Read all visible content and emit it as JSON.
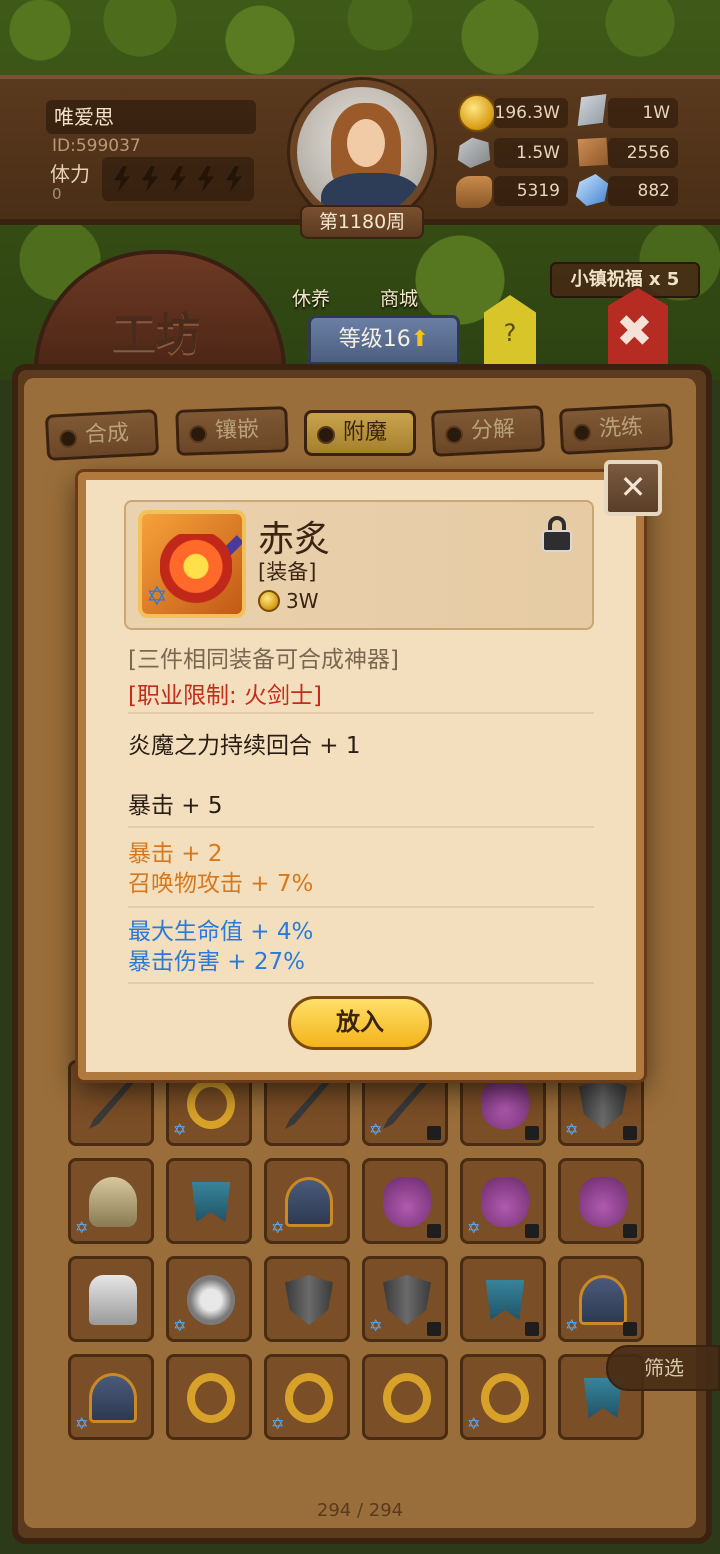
{
  "player": {
    "name": "唯爱思",
    "id": "ID:599037",
    "stamina_label": "体力",
    "stamina_value": "0",
    "week": "第1180周"
  },
  "resources": {
    "gold": "196.3W",
    "iron": "1W",
    "stone": "1.5W",
    "leather": "2556",
    "wood": "5319",
    "crystal": "882"
  },
  "nav": {
    "workshop_title": "工坊",
    "rest_label": "休养",
    "shop_label": "商城",
    "level_label": "等级16",
    "help_label": "?",
    "town_blessing": "小镇祝福 x 5"
  },
  "tabs": [
    {
      "label": "合成",
      "active": false
    },
    {
      "label": "镶嵌",
      "active": false
    },
    {
      "label": "附魔",
      "active": true
    },
    {
      "label": "分解",
      "active": false
    },
    {
      "label": "洗练",
      "active": false
    }
  ],
  "item": {
    "name": "赤炙",
    "type": "[装备]",
    "price": "3W",
    "note": "[三件相同装备可合成神器]",
    "restriction": "[职业限制: 火剑士]",
    "base_stats": [
      "炎魔之力持续回合 + 1",
      "暴击 + 5"
    ],
    "orange_stats": [
      "暴击 + 2",
      "召唤物攻击 + 7%"
    ],
    "blue_stats": [
      "最大生命值 + 4%",
      "暴击伤害 + 27%"
    ],
    "put_in_label": "放入"
  },
  "inventory": {
    "filter_label": "筛选",
    "counter": "294 / 294",
    "icons": [
      [
        "blade",
        "ring",
        "blade",
        "blade",
        "bag",
        "shield"
      ],
      [
        "hood",
        "mask",
        "helm",
        "bag",
        "bag",
        "bag"
      ],
      [
        "lamp",
        "amulet",
        "shield",
        "shield",
        "mask",
        "helm"
      ],
      [
        "helm",
        "ring",
        "ring",
        "ring",
        "ring",
        "mask"
      ]
    ]
  },
  "colors": {
    "red_text": "#c42c1c",
    "orange_text": "#d6781e",
    "blue_text": "#2a7ad8",
    "gold": "#f4b41a"
  }
}
